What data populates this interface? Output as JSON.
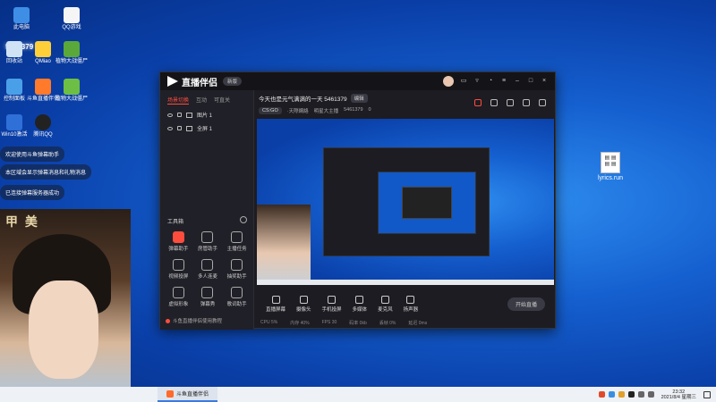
{
  "desktop": {
    "icons": [
      {
        "label": "此电脑"
      },
      {
        "label": "QQ游戏"
      },
      {
        "label": "回收站"
      },
      {
        "label": "QMiao"
      },
      {
        "label": "植物大战僵尸"
      },
      {
        "label": "控制面板"
      },
      {
        "label": "斗鱼直播伴侣"
      },
      {
        "label": "植物大战僵尸"
      },
      {
        "label": "Win10激活"
      },
      {
        "label": "腾讯QQ"
      }
    ],
    "lyrics_file": "lyrics.run",
    "overlay_id": "5463379",
    "chat": [
      "欢迎使用斗鱼弹幕助手",
      "本区域会显示弹幕消息和礼物消息",
      "已连接弹幕服务器成功"
    ],
    "cam_sign": "甲 美"
  },
  "app": {
    "name": "直播伴侣",
    "version_badge": "新版",
    "tabs": [
      "场景切换",
      "互动",
      "可直关"
    ],
    "scenes": [
      "图片 1",
      "全屏 1"
    ],
    "room_title": "今天也是元气满满的一天 5461379",
    "edit_label": "编辑",
    "room_meta": [
      "CS:GO",
      "·天際網絡",
      "明星大主播",
      "5461379",
      "0"
    ],
    "toolbox_title": "工具箱",
    "tools": [
      {
        "label": "弹幕助手",
        "hot": true
      },
      {
        "label": "房管助手",
        "hot": false
      },
      {
        "label": "主播任务",
        "hot": false
      },
      {
        "label": "视频投屏",
        "hot": false
      },
      {
        "label": "多人连麦",
        "hot": false
      },
      {
        "label": "抽奖助手",
        "hot": false
      },
      {
        "label": "虚拟形象",
        "hot": false
      },
      {
        "label": "弹幕秀",
        "hot": false
      },
      {
        "label": "歌词助手",
        "hot": false
      }
    ],
    "status_text": "斗鱼直播伴侣使用教程",
    "controls": [
      "直播屏幕",
      "摄像头",
      "手机投屏",
      "多媒体",
      "麦克风",
      "扬声器"
    ],
    "start_button": "开始直播",
    "footer": [
      "CPU 5%",
      "内存 40%",
      "FPS 30",
      "码率 0kb",
      "丢帧 0%",
      "延迟 0ms"
    ]
  },
  "taskbar": {
    "app_label": "斗鱼直播伴侣",
    "time": "23:32",
    "date": "2021/8/4 星期三"
  },
  "colors": {
    "accent": "#ff4d3d",
    "desktop": "#1560d0"
  }
}
